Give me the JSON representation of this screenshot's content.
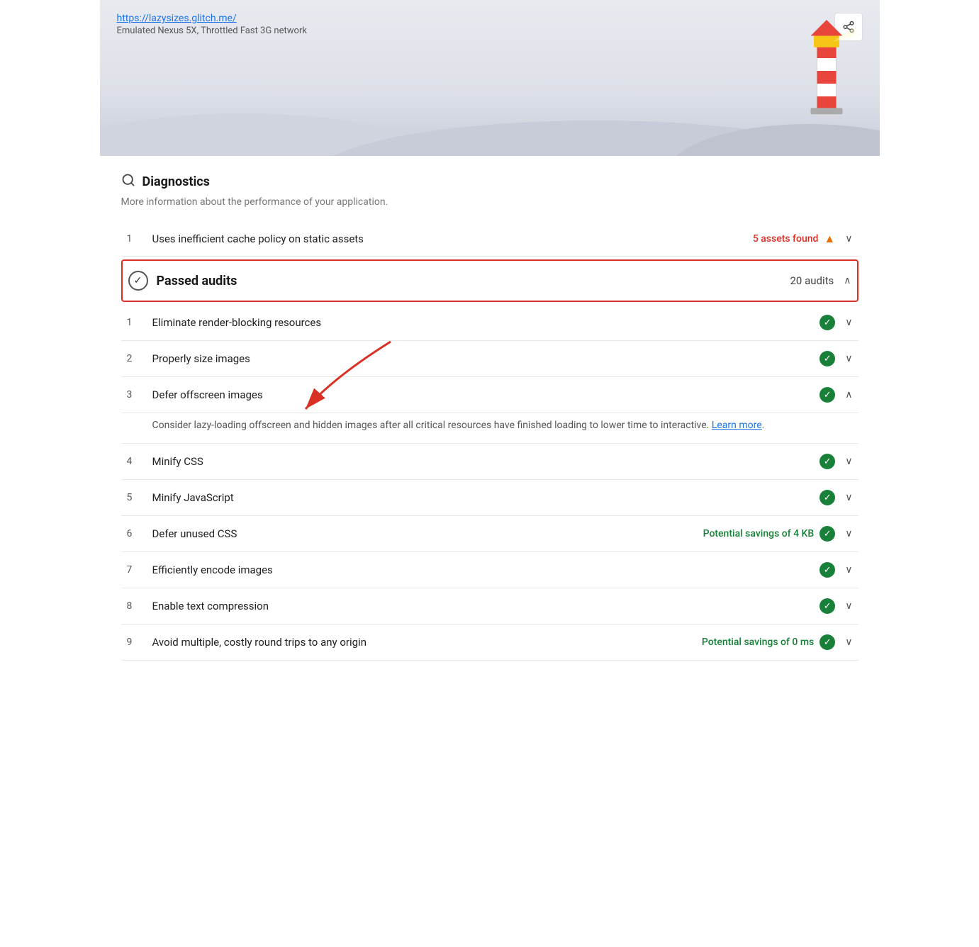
{
  "header": {
    "url": "https://lazysizes.glitch.me/",
    "device": "Emulated Nexus 5X, Throttled Fast 3G network",
    "share_label": "share"
  },
  "diagnostics": {
    "title": "Diagnostics",
    "subtitle": "More information about the performance of your application.",
    "items": [
      {
        "num": "1",
        "title": "Uses inefficient cache policy on static assets",
        "assets_found": "5 assets found",
        "has_warning": true
      }
    ]
  },
  "passed_audits": {
    "title": "Passed audits",
    "count": "20 audits",
    "items": [
      {
        "num": "1",
        "title": "Eliminate render-blocking resources",
        "savings": "",
        "expanded": false
      },
      {
        "num": "2",
        "title": "Properly size images",
        "savings": "",
        "expanded": false
      },
      {
        "num": "3",
        "title": "Defer offscreen images",
        "savings": "",
        "expanded": true,
        "description": "Consider lazy-loading offscreen and hidden images after all critical resources have finished loading to lower time to interactive.",
        "learn_more": "Learn more"
      },
      {
        "num": "4",
        "title": "Minify CSS",
        "savings": "",
        "expanded": false
      },
      {
        "num": "5",
        "title": "Minify JavaScript",
        "savings": "",
        "expanded": false
      },
      {
        "num": "6",
        "title": "Defer unused CSS",
        "savings": "Potential savings of 4 KB",
        "expanded": false
      },
      {
        "num": "7",
        "title": "Efficiently encode images",
        "savings": "",
        "expanded": false
      },
      {
        "num": "8",
        "title": "Enable text compression",
        "savings": "",
        "expanded": false
      },
      {
        "num": "9",
        "title": "Avoid multiple, costly round trips to any origin",
        "savings": "Potential savings of 0 ms",
        "expanded": false
      }
    ]
  },
  "colors": {
    "red": "#d93025",
    "green": "#188038",
    "orange": "#e8710a",
    "blue": "#1a73e8"
  }
}
